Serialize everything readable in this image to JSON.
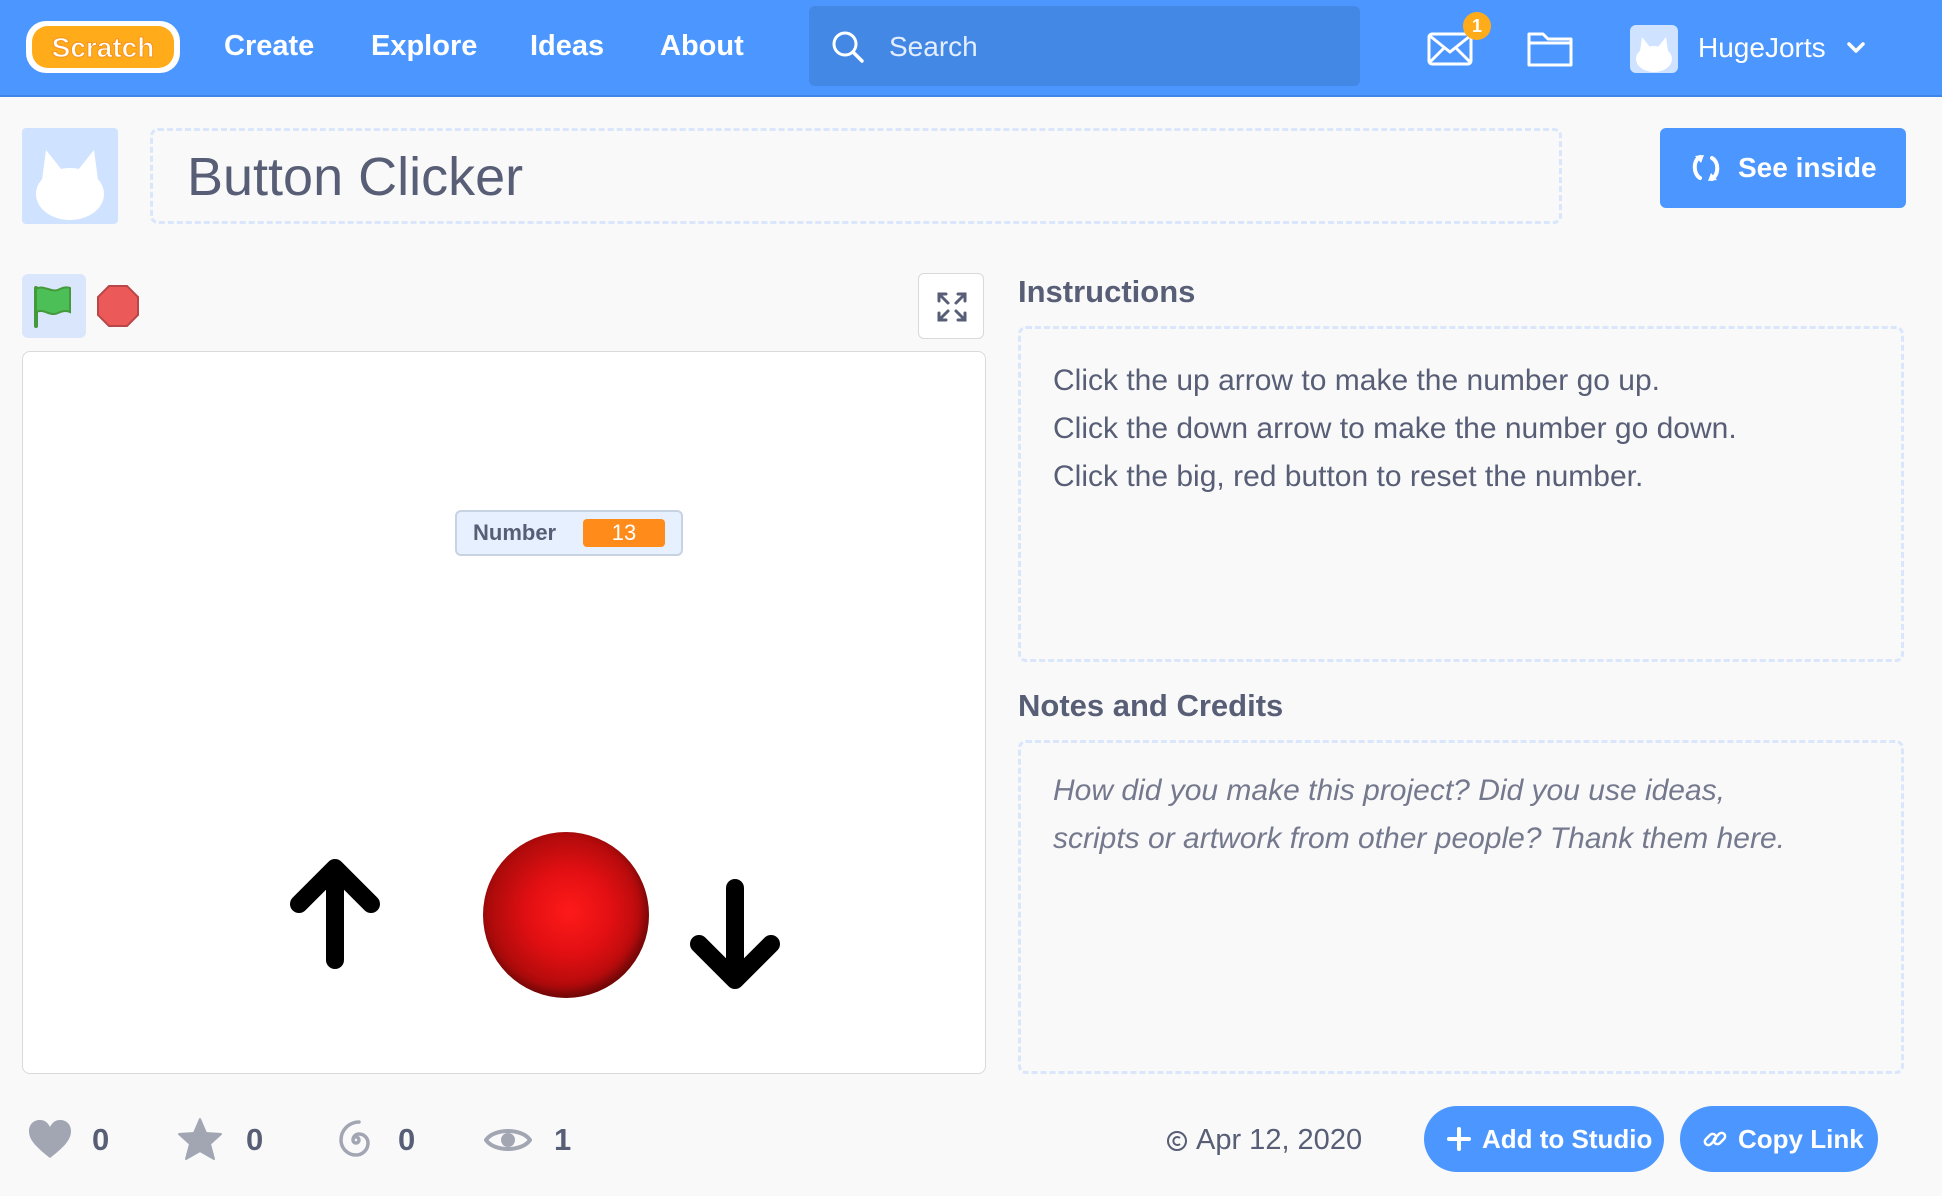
{
  "nav": {
    "logo_text": "Scratch",
    "links": [
      "Create",
      "Explore",
      "Ideas",
      "About"
    ],
    "search_placeholder": "Search",
    "messages_count": "1",
    "username": "HugeJorts"
  },
  "project": {
    "title": "Button Clicker",
    "see_inside_label": "See inside"
  },
  "stage": {
    "monitor_label": "Number",
    "monitor_value": "13"
  },
  "instructions": {
    "heading": "Instructions",
    "lines": [
      "Click the up arrow to make the number go up.",
      "Click the down arrow to make the number go down.",
      "Click the big, red button to reset the number."
    ]
  },
  "notes": {
    "heading": "Notes and Credits",
    "placeholder_lines": [
      "How did you make this project? Did you use ideas,",
      "scripts or artwork from other people? Thank them here."
    ]
  },
  "stats": {
    "loves": "0",
    "favorites": "0",
    "remixes": "0",
    "views": "1"
  },
  "footer": {
    "date": "Apr 12, 2020",
    "add_to_studio_label": "Add to Studio",
    "copy_link_label": "Copy Link"
  },
  "colors": {
    "nav_blue": "#4c97ff",
    "text": "#575e75",
    "monitor_orange": "#ff8c1a",
    "badge": "#ffab1a",
    "flag_green": "#4cbf56",
    "stop_red": "#ec5959"
  },
  "icons": [
    "search-icon",
    "envelope-icon",
    "folder-icon",
    "chevron-down-icon",
    "remix-icon",
    "green-flag-icon",
    "stop-icon",
    "fullscreen-icon",
    "heart-icon",
    "star-icon",
    "spiral-icon",
    "eye-icon",
    "copyright-icon",
    "plus-icon",
    "link-icon"
  ]
}
